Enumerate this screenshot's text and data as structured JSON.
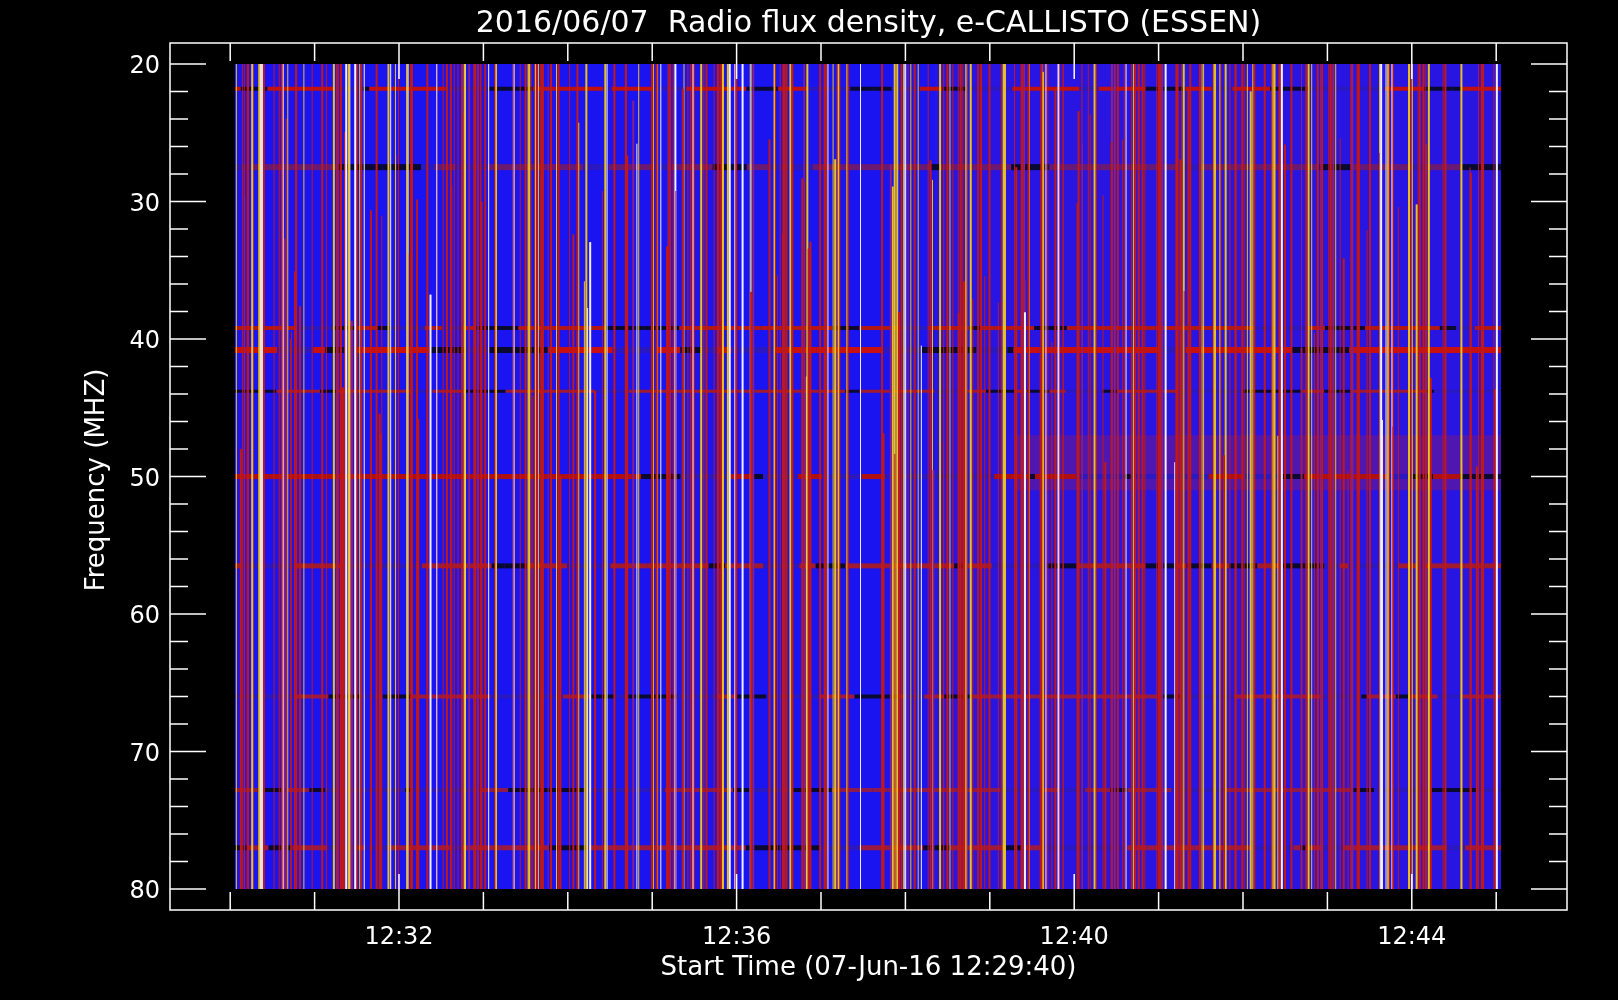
{
  "title": "2016/06/07  Radio flux density, e-CALLISTO (ESSEN)",
  "y_axis": {
    "label": "Frequency (MHZ)",
    "ticks": [
      "20",
      "30",
      "40",
      "50",
      "60",
      "70",
      "80"
    ]
  },
  "x_axis": {
    "label": "Start Time (07-Jun-16 12:29:40)",
    "ticks": [
      "12:32",
      "12:36",
      "12:40",
      "12:44"
    ]
  }
}
